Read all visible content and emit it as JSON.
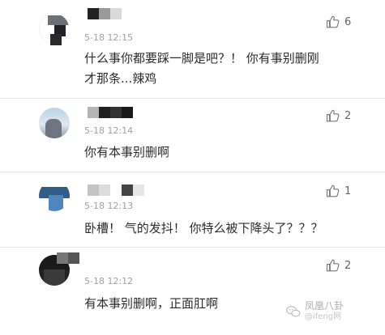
{
  "comments": [
    {
      "date": "5-18 12:15",
      "text_line1": "什么事你都要踩一脚是吧？！ 你有事别删刚",
      "text_line2": "才那条...辣鸡",
      "likes": "6"
    },
    {
      "date": "5-18 12:14",
      "text_line1": "你有本事别删啊",
      "likes": "2"
    },
    {
      "date": "5-18 12:13",
      "text_line1": "卧槽！ 气的发抖！ 你特么被下降头了？？？",
      "likes": "1"
    },
    {
      "date": "5-18 12:12",
      "text_line1": "有本事别删啊，正面肛啊",
      "likes": "2"
    }
  ],
  "watermark": {
    "name": "凤凰八卦",
    "handle": "@ifeng网",
    "icon": "wechat-bubble-icon"
  },
  "icons": {
    "like": "thumbs-up-icon"
  }
}
